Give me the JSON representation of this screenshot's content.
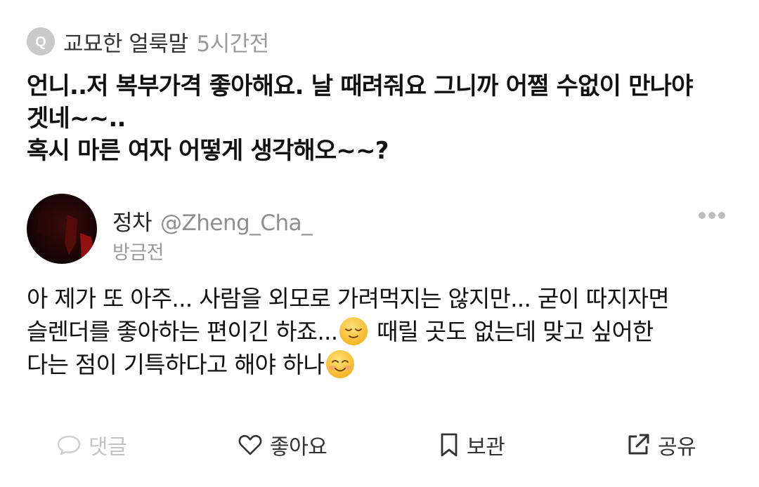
{
  "question": {
    "badge_letter": "Q",
    "author": "교묘한 얼룩말",
    "time": "5시간전",
    "lines": [
      "언니..저 복부가격 좋아해요. 날 때려줘요 그니까 어쩔 수없이 만나야",
      "겟네~~..",
      "혹시 마른 여자 어떻게 생각해오~~?"
    ]
  },
  "answer": {
    "name": "정차",
    "handle": "@Zheng_Cha_",
    "time": "방금전",
    "line1": "아 제가 또 아주... 사람을 외모로 가려먹지는 않지만... 굳이 따지자면",
    "line2_a": "슬렌더를 좋아하는 편이긴 하죠...",
    "line2_b": " 때릴 곳도 없는데 맞고 싶어한",
    "line3": "다는 점이 기특하다고 해야 하나",
    "emoji_1": "relieved-face-emoji",
    "emoji_2": "smiling-face-emoji"
  },
  "actions": {
    "comment_label": "댓글",
    "like_label": "좋아요",
    "save_label": "보관",
    "share_label": "공유"
  },
  "colors": {
    "badge_bg": "#c9c9c9",
    "muted_text": "#9a9a9a",
    "disabled_text": "#c4c4c4",
    "primary_text": "#111111"
  }
}
